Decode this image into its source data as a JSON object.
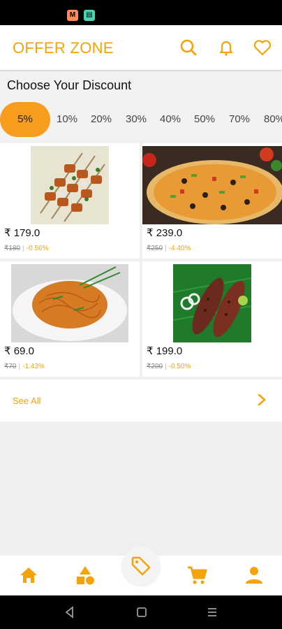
{
  "header": {
    "title": "OFFER ZONE",
    "icons": [
      "search-icon",
      "bell-icon",
      "heart-icon"
    ]
  },
  "discount": {
    "title": "Choose Your Discount",
    "options": [
      "5%",
      "10%",
      "20%",
      "30%",
      "40%",
      "50%",
      "70%",
      "80%"
    ],
    "selected": "5%"
  },
  "products": [
    {
      "image": "paneer-tikka-skewers",
      "price": "₹ 179.0",
      "old_price": "₹180",
      "discount": "-0.56%"
    },
    {
      "image": "pizza",
      "price": "₹ 239.0",
      "old_price": "₹250",
      "discount": "-4.40%"
    },
    {
      "image": "noodles-plate",
      "price": "₹ 69.0",
      "old_price": "₹70",
      "discount": "-1.43%"
    },
    {
      "image": "fried-fish-on-banana-leaf",
      "price": "₹ 199.0",
      "old_price": "₹200",
      "discount": "-0.50%"
    }
  ],
  "see_all": {
    "label": "See All"
  },
  "bottom_nav": {
    "items": [
      "home-icon",
      "categories-icon",
      "offers-tag-icon",
      "cart-icon",
      "profile-icon"
    ],
    "active": "offers-tag-icon"
  },
  "colors": {
    "accent": "#f5a30a",
    "chip_active": "#f79c1d"
  }
}
